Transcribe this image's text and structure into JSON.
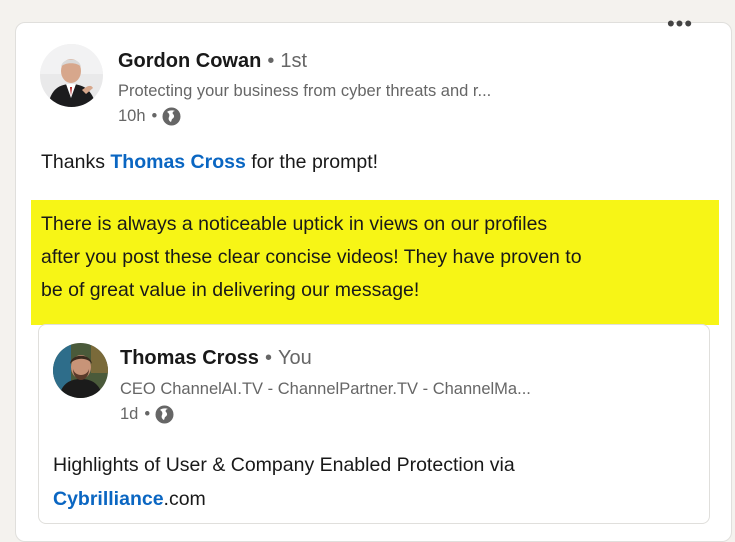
{
  "post": {
    "author": {
      "name": "Gordon Cowan",
      "degree": "1st",
      "headline": "Protecting your business from cyber threats and r...",
      "time": "10h",
      "separator": "•",
      "visibility_icon": "globe-icon"
    },
    "more_icon": "more-options-icon",
    "more_label": "•••",
    "text": {
      "prefix": "Thanks ",
      "mention": "Thomas Cross",
      "suffix": " for the prompt!"
    },
    "highlight_lines": [
      "There is always a noticeable uptick in views on our profiles",
      "after you post these clear concise videos! They have proven to",
      "be of great value in delivering our message!"
    ],
    "highlight_color": "#f7f516"
  },
  "reshare": {
    "author": {
      "name": "Thomas Cross",
      "degree": "You",
      "headline": "CEO ChannelAI.TV - ChannelPartner.TV - ChannelMa...",
      "time": "1d",
      "separator": "•",
      "visibility_icon": "globe-icon"
    },
    "text_line1": "Highlights of User & Company Enabled Protection via",
    "link": "Cybrilliance",
    "link_suffix": ".com"
  },
  "colors": {
    "link": "#0a66c2",
    "text": "#191919",
    "muted": "#666666",
    "background": "#f4f2ee"
  }
}
